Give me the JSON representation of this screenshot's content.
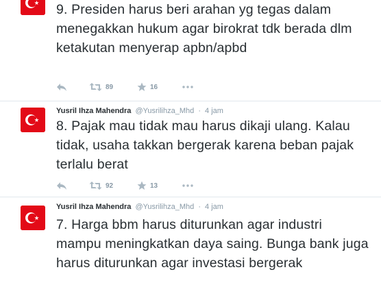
{
  "tweets": [
    {
      "author_name": "",
      "handle": "",
      "time": "",
      "text": "9. Presiden harus beri arahan yg tegas dalam menegakkan hukum agar birokrat tdk berada dlm ketakutan menyerap apbn/apbd",
      "retweets": "89",
      "favorites": "16"
    },
    {
      "author_name": "Yusril Ihza Mahendra",
      "handle": "@Yusrilihza_Mhd",
      "separator": "·",
      "time": "4 jam",
      "text": "8. Pajak mau tidak mau harus dikaji ulang. Kalau tidak, usaha takkan bergerak karena beban pajak terlalu berat",
      "retweets": "92",
      "favorites": "13"
    },
    {
      "author_name": "Yusril Ihza Mahendra",
      "handle": "@Yusrilihza_Mhd",
      "separator": "·",
      "time": "4 jam",
      "text": "7. Harga bbm harus diturunkan agar industri mampu meningkatkan daya saing. Bunga bank juga harus diturunkan agar investasi bergerak"
    }
  ],
  "icons": {
    "avatar": "turkish-flag-avatar",
    "reply": "reply-icon",
    "retweet": "retweet-icon",
    "favorite": "star-icon",
    "more": "more-dots-icon"
  },
  "colors": {
    "text": "#292f33",
    "muted": "#8899a6",
    "icon": "#aab8c2",
    "divider": "#e1e8ed",
    "flag_red": "#e30a17"
  }
}
